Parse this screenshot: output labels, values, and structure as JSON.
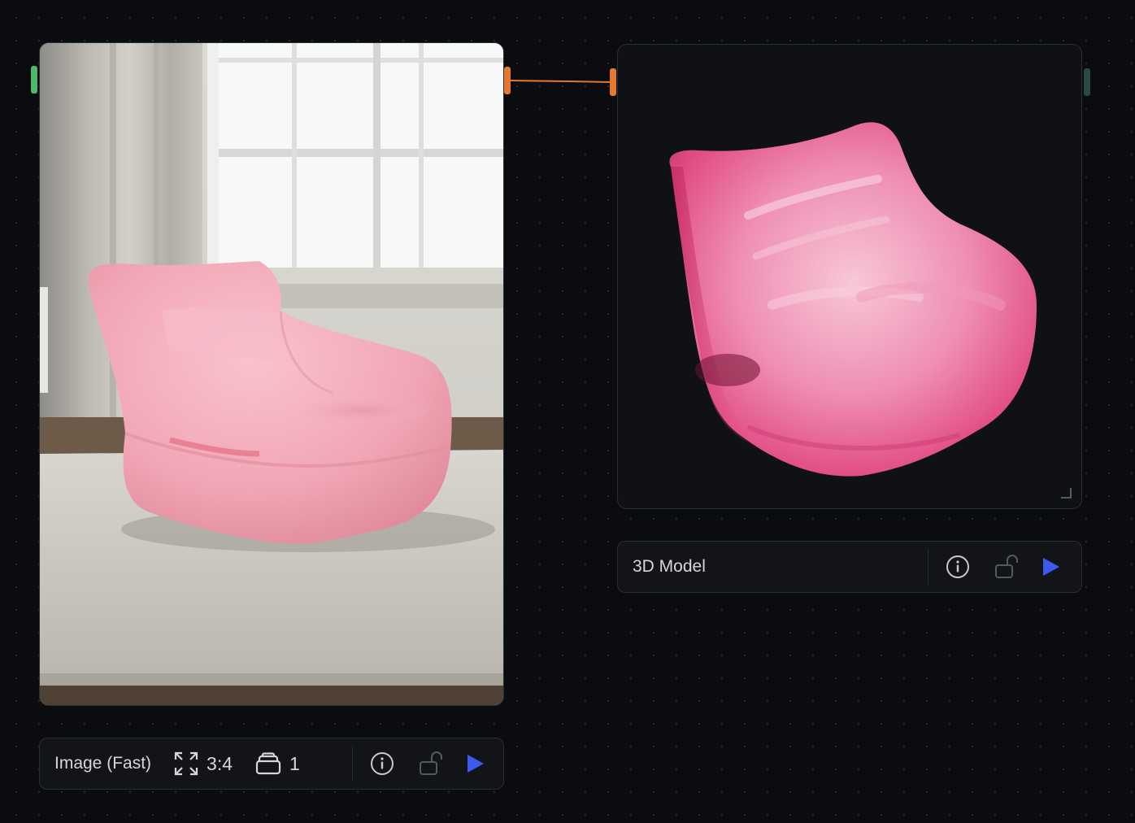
{
  "image_node": {
    "title": "Image (Fast)",
    "aspect_ratio": "3:4",
    "count": "1",
    "icons": [
      "expand-icon",
      "layers-icon",
      "info-icon",
      "unlock-icon",
      "play-icon"
    ]
  },
  "model_node": {
    "title": "3D Model",
    "icons": [
      "info-icon",
      "unlock-icon",
      "play-icon",
      "resize-icon"
    ]
  },
  "colors": {
    "background": "#0b0c0f",
    "port_input_green": "#4fb86a",
    "port_orange": "#e6782d",
    "port_output_teal": "#2b4a46",
    "play_blue": "#3b5bef",
    "chair_pink": "#f0a2b3",
    "model_pink": "#e3407e"
  }
}
